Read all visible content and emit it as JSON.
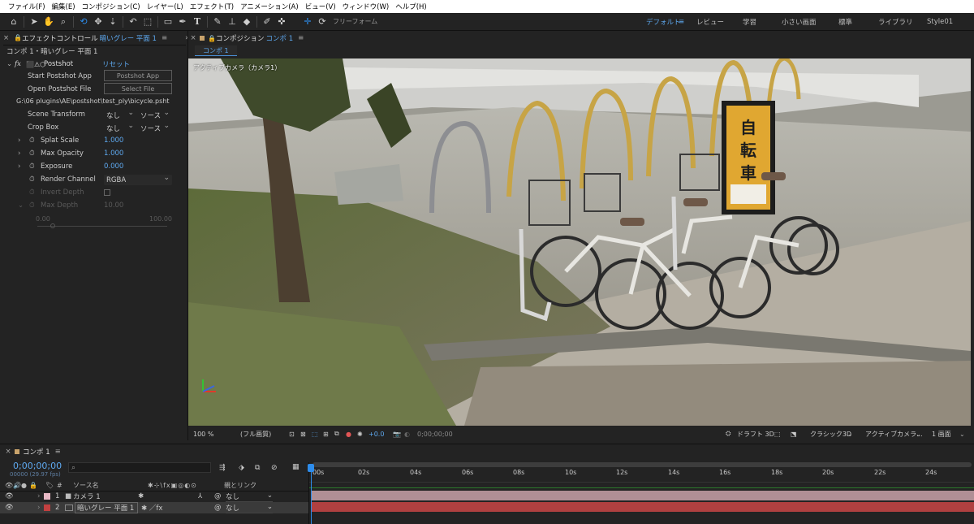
{
  "menu": [
    "ファイル(F)",
    "編集(E)",
    "コンポジション(C)",
    "レイヤー(L)",
    "エフェクト(T)",
    "アニメーション(A)",
    "ビュー(V)",
    "ウィンドウ(W)",
    "ヘルプ(H)"
  ],
  "toolbar": {
    "freeform_label": "フリーフォーム"
  },
  "workspaces": [
    "デフォルト",
    "レビュー",
    "学習",
    "小さい画面",
    "標準",
    "ライブラリ",
    "Style01"
  ],
  "effects_panel": {
    "tab_label": "エフェクトコントロール",
    "tab_layer": "暗いグレー 平面 1",
    "breadcrumb": "コンポ 1・暗いグレー 平面 1",
    "effect_name": "Postshot",
    "reset_label": "リセット",
    "start_app_label": "Start Postshot App",
    "start_app_button": "Postshot App",
    "open_file_label": "Open Postshot File",
    "open_file_button": "Select File",
    "file_path": "G:\\06 plugins\\AE\\postshot\\test_ply\\bicycle.psht",
    "scene_transform_label": "Scene Transform",
    "scene_transform_a": "なし",
    "scene_transform_b": "ソース",
    "crop_box_label": "Crop Box",
    "crop_box_a": "なし",
    "crop_box_b": "ソース",
    "splat_scale_label": "Splat Scale",
    "splat_scale_value": "1.000",
    "max_opacity_label": "Max Opacity",
    "max_opacity_value": "1.000",
    "exposure_label": "Exposure",
    "exposure_value": "0.000",
    "render_channel_label": "Render Channel",
    "render_channel_value": "RGBA",
    "invert_depth_label": "Invert Depth",
    "max_depth_label": "Max Depth",
    "max_depth_value": "10.00",
    "slider_min": "0.00",
    "slider_max": "100.00"
  },
  "comp_panel": {
    "tab_label": "コンポジション",
    "tab_comp": "コンポ 1",
    "comp_button": "コンポ 1",
    "camera_label": "アクティブカメラ（カメラ1）",
    "sign_text": "自転車"
  },
  "viewer_bar": {
    "zoom": "100 %",
    "resolution": "(フル画質)",
    "exposure": "+0.0",
    "timecode": "0;00;00;00",
    "draft": "ドラフト 3D",
    "renderer": "クラシック3D",
    "camera": "アクティブカメラ...",
    "views": "1 画面"
  },
  "timeline": {
    "tab_label": "コンポ 1",
    "timecode": "0;00;00;00",
    "frame_info": "00000 (29.97 fps)",
    "search_placeholder": "",
    "col_source": "ソース名",
    "col_parent": "親とリンク",
    "layers": [
      {
        "num": "1",
        "name": "カメラ 1",
        "parent": "なし",
        "color": "#e7b8c4"
      },
      {
        "num": "2",
        "name": "暗いグレー 平面 1",
        "parent": "なし",
        "color": "#c24040"
      }
    ],
    "ruler": [
      "00s",
      "02s",
      "04s",
      "06s",
      "08s",
      "10s",
      "12s",
      "14s",
      "16s",
      "18s",
      "20s",
      "22s",
      "24s"
    ]
  },
  "colors": {
    "accent": "#2d8ceb",
    "layer1_bar": "#b08f95",
    "layer2_bar": "#b04040"
  }
}
